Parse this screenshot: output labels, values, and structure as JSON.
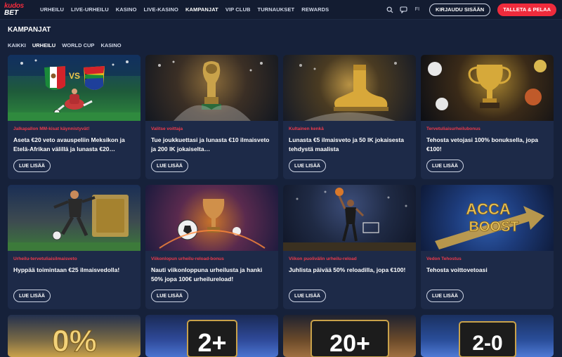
{
  "header": {
    "logo_top": "kudos",
    "logo_bottom": "BET",
    "nav": [
      {
        "label": "URHEILU",
        "active": false
      },
      {
        "label": "LIVE-URHEILU",
        "active": false
      },
      {
        "label": "KASINO",
        "active": false
      },
      {
        "label": "LIVE-KASINO",
        "active": false
      },
      {
        "label": "KAMPANJAT",
        "active": true
      },
      {
        "label": "VIP CLUB",
        "active": false
      },
      {
        "label": "TURNAUKSET",
        "active": false
      },
      {
        "label": "REWARDS",
        "active": false
      }
    ],
    "lang": "FI",
    "login_label": "KIRJAUDU SISÄÄN",
    "deposit_label": "TALLETA & PELAA",
    "icons": [
      "search-icon",
      "chat-icon"
    ]
  },
  "page": {
    "title": "KAMPANJAT",
    "filters": [
      {
        "label": "KAIKKI",
        "active": false
      },
      {
        "label": "URHEILU",
        "active": true
      },
      {
        "label": "WORLD CUP",
        "active": false
      },
      {
        "label": "KASINO",
        "active": false
      }
    ]
  },
  "cards": [
    {
      "tag": "Jalkapallon MM-kisat käynnistyvät!",
      "title": "Aseta €20 veto avauspeliin Meksikon ja Etelä-Afrikan välillä ja lunasta €20…",
      "button": "LUE LISÄÄ"
    },
    {
      "tag": "Valitse voittaja",
      "title": "Tue joukkuettasi ja lunasta €10 ilmaisveto ja 200 IK jokaiselta…",
      "button": "LUE LISÄÄ"
    },
    {
      "tag": "Kultainen kenkä",
      "title": "Lunasta €5 ilmaisveto ja 50 IK jokaisesta tehdystä maalista",
      "button": "LUE LISÄÄ"
    },
    {
      "tag": "Tervetuliaisurheilubonus",
      "title": "Tehosta vetojasi 100% bonuksella, jopa €100!",
      "button": "LUE LISÄÄ"
    },
    {
      "tag": "Urheilu-tervetuliaisilmaisveto",
      "title": "Hyppää toimintaan €25 ilmaisvedolla!",
      "button": "LUE LISÄÄ"
    },
    {
      "tag": "Viikonlopun urheilu-reload-bonus",
      "title": "Nauti viikonloppuna urheilusta ja hanki 50% jopa 100€ urheilureload!",
      "button": "LUE LISÄÄ"
    },
    {
      "tag": "Viikon puolivälin urheilu-reload",
      "title": "Juhlista päivää 50% reloadilla, jopa €100!",
      "button": "LUE LISÄÄ"
    },
    {
      "tag": "Vedon Tehostus",
      "title": "Tehosta voittovetoasi",
      "button": "LUE LISÄÄ"
    }
  ],
  "card_images": {
    "vs_text": "VS",
    "acca_line1": "ACCA",
    "acca_line2": "BOOST",
    "bottom_row": [
      "0%",
      "2+",
      "20+",
      "2-0"
    ]
  },
  "colors": {
    "background": "#16213a",
    "topbar": "#131c31",
    "card": "#1d2a48",
    "accent_red": "#ef2b3c",
    "tag_red": "#ef3b4b"
  }
}
